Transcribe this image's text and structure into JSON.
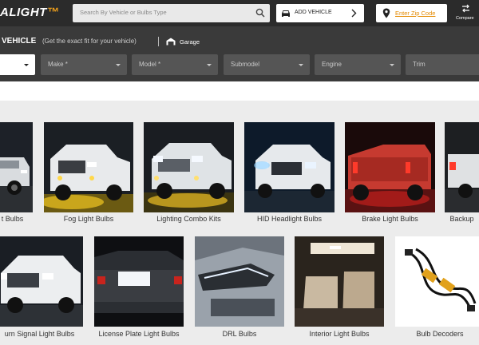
{
  "header": {
    "logo_text": "ALIGHT",
    "search_placeholder": "Search By Vehicle or Bulbs Type",
    "add_vehicle_label": "ADD VEHICLE",
    "zip_label": "Enter Zip Code",
    "compare_label": "Compare"
  },
  "vehicle_bar": {
    "title": "VEHICLE",
    "subtitle": "(Get the exact fit for your vehicle)",
    "garage_label": "Garage",
    "selects": [
      {
        "label": ""
      },
      {
        "label": "Make *"
      },
      {
        "label": "Model *"
      },
      {
        "label": "Submodel"
      },
      {
        "label": "Engine"
      },
      {
        "label": "Trim"
      }
    ]
  },
  "categories_row1": [
    {
      "label": "t Bulbs",
      "image": "truck-white"
    },
    {
      "label": "Fog Light Bulbs",
      "image": "truck-fog"
    },
    {
      "label": "Lighting Combo Kits",
      "image": "truck-combo"
    },
    {
      "label": "HID Headlight Bulbs",
      "image": "suv-hid"
    },
    {
      "label": "Brake Light Bulbs",
      "image": "truck-brake"
    },
    {
      "label": "Backup",
      "image": "truck-backup"
    }
  ],
  "categories_row2": [
    {
      "label": "urn Signal Light Bulbs",
      "image": "truck-turn"
    },
    {
      "label": "License Plate Light Bulbs",
      "image": "car-license"
    },
    {
      "label": "DRL Bulbs",
      "image": "car-drl"
    },
    {
      "label": "Interior Light Bulbs",
      "image": "car-interior"
    },
    {
      "label": "Bulb Decoders",
      "image": "decoder-harness"
    }
  ],
  "colors": {
    "topbar": "#2b2b2b",
    "vehicle_bar": "#3a3a3a",
    "accent": "#f3a21c",
    "grid_bg": "#ececec"
  }
}
